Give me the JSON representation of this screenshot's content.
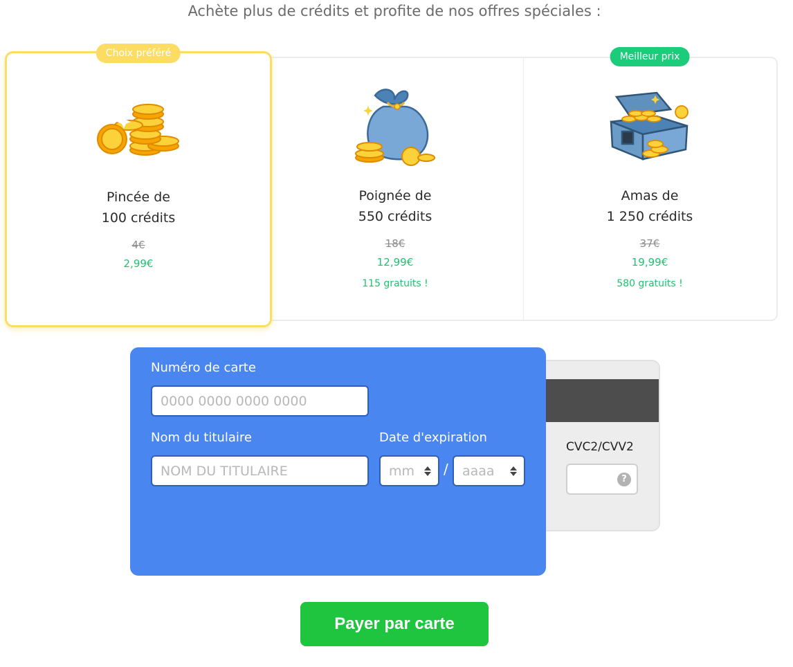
{
  "headline": "Achète plus de crédits et profite de nos offres spéciales :",
  "offers": [
    {
      "badge": "Choix préféré",
      "title_line1": "Pincée de",
      "title_line2": "100 crédits",
      "old_price": "4€",
      "price": "2,99€",
      "bonus": "",
      "icon": "coin-stack-icon",
      "selected": true
    },
    {
      "badge": "",
      "title_line1": "Poignée de",
      "title_line2": "550 crédits",
      "old_price": "18€",
      "price": "12,99€",
      "bonus": "115 gratuits !",
      "icon": "money-bag-icon",
      "selected": false
    },
    {
      "badge": "Meilleur prix",
      "title_line1": "Amas de",
      "title_line2": "1 250 crédits",
      "old_price": "37€",
      "price": "19,99€",
      "bonus": "580 gratuits !",
      "icon": "treasure-chest-icon",
      "selected": false
    }
  ],
  "payment": {
    "card_number_label": "Numéro de carte",
    "card_number_placeholder": "0000 0000 0000 0000",
    "holder_label": "Nom du titulaire",
    "holder_placeholder": "NOM DU TITULAIRE",
    "expiry_label": "Date d'expiration",
    "month_placeholder": "mm",
    "year_placeholder": "aaaa",
    "separator": "/",
    "cvc_label": "CVC2/CVV2",
    "help_glyph": "?"
  },
  "pay_button": "Payer par carte",
  "colors": {
    "selected_border": "#fcdc63",
    "best_price_badge": "#1ccc7a",
    "price_green": "#1ec26f",
    "card_blue": "#4a86ef",
    "pay_button": "#1fc43f"
  }
}
